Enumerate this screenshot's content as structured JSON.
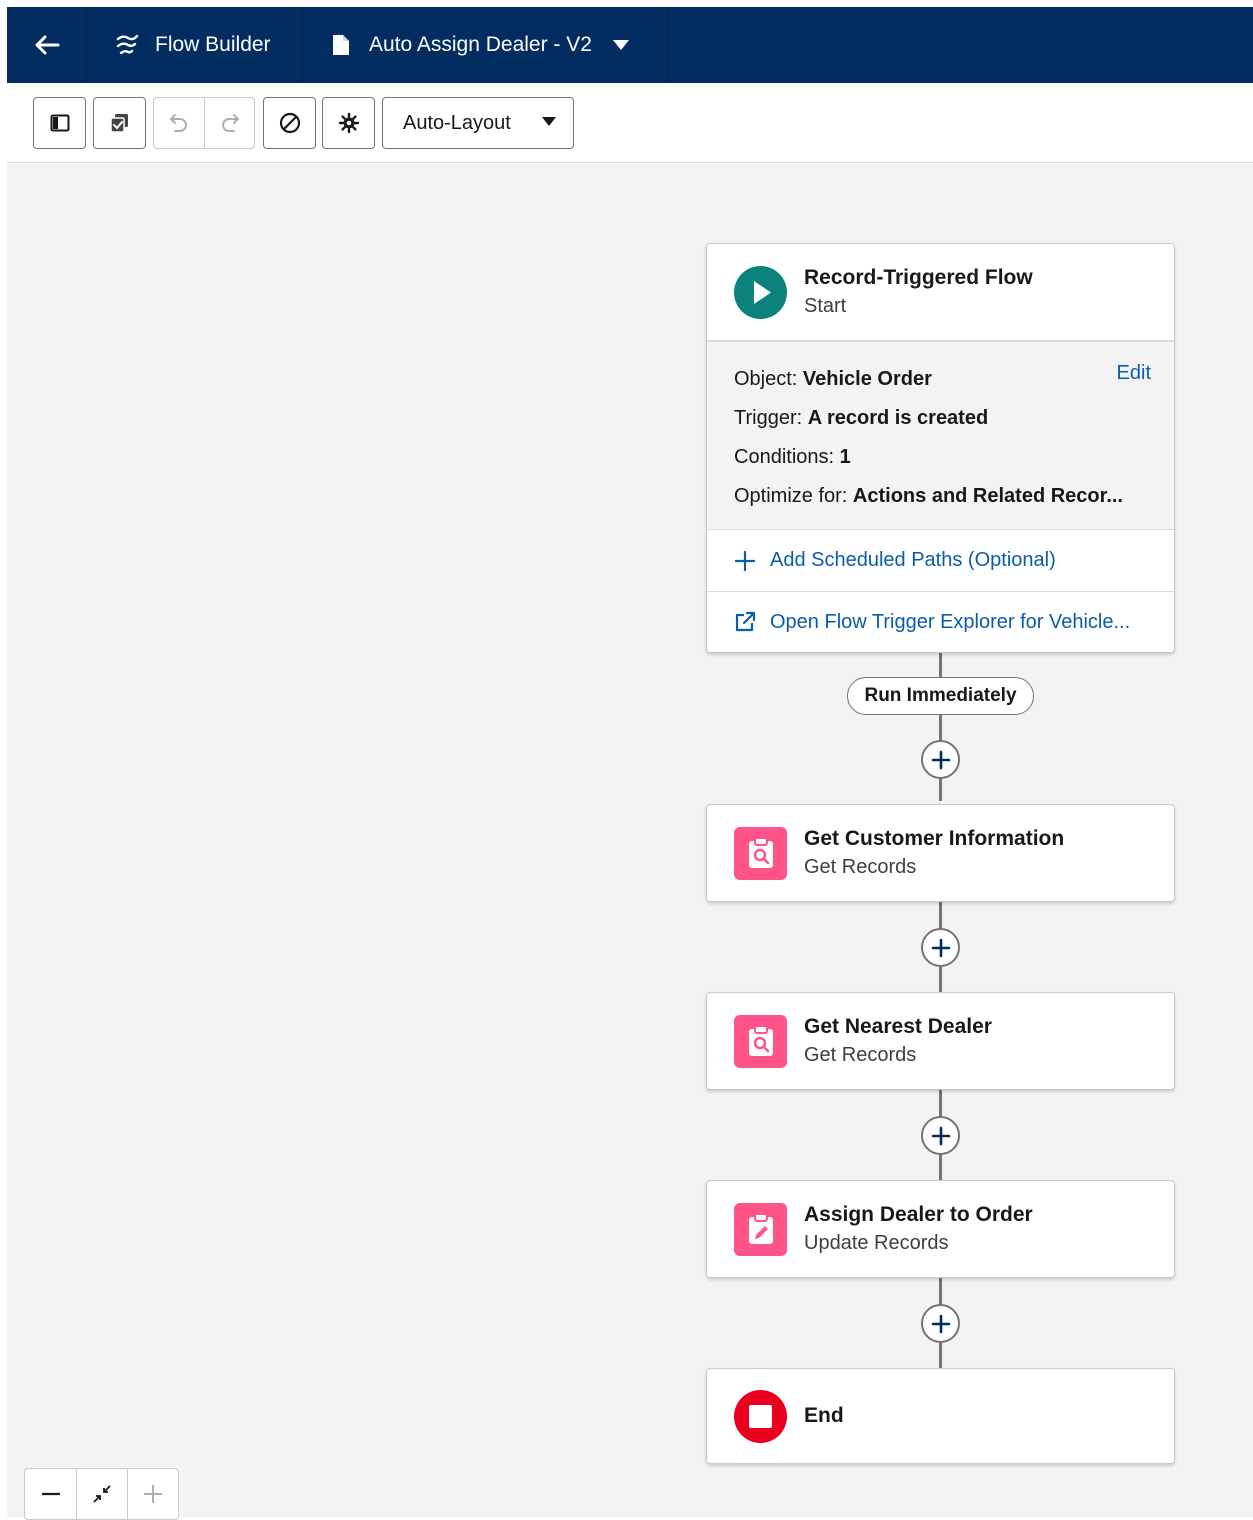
{
  "header": {
    "app_name": "Flow Builder",
    "flow_name": "Auto Assign Dealer - V2"
  },
  "toolbar": {
    "layout_mode": "Auto-Layout"
  },
  "start_element": {
    "title": "Record-Triggered Flow",
    "subtitle": "Start",
    "object_label": "Object: ",
    "object_value": "Vehicle Order",
    "edit_label": "Edit",
    "trigger_label": "Trigger: ",
    "trigger_value": "A record is created",
    "conditions_label": "Conditions: ",
    "conditions_value": "1",
    "optimize_label": "Optimize for: ",
    "optimize_value": "Actions and Related Recor...",
    "add_scheduled_paths": "Add Scheduled Paths (Optional)",
    "open_trigger_explorer": "Open Flow Trigger Explorer for Vehicle..."
  },
  "path_label": "Run Immediately",
  "elements": [
    {
      "title": "Get Customer Information",
      "subtitle": "Get Records",
      "icon": "record-lookup-icon"
    },
    {
      "title": "Get Nearest Dealer",
      "subtitle": "Get Records",
      "icon": "record-lookup-icon"
    },
    {
      "title": "Assign Dealer to Order",
      "subtitle": "Update Records",
      "icon": "record-update-icon"
    }
  ],
  "end_element": {
    "title": "End"
  },
  "colors": {
    "header_bg": "#032d60",
    "start_icon": "#0b827c",
    "element_icon": "#ff538a",
    "end_icon": "#ea001e",
    "link": "#0b5cab"
  }
}
